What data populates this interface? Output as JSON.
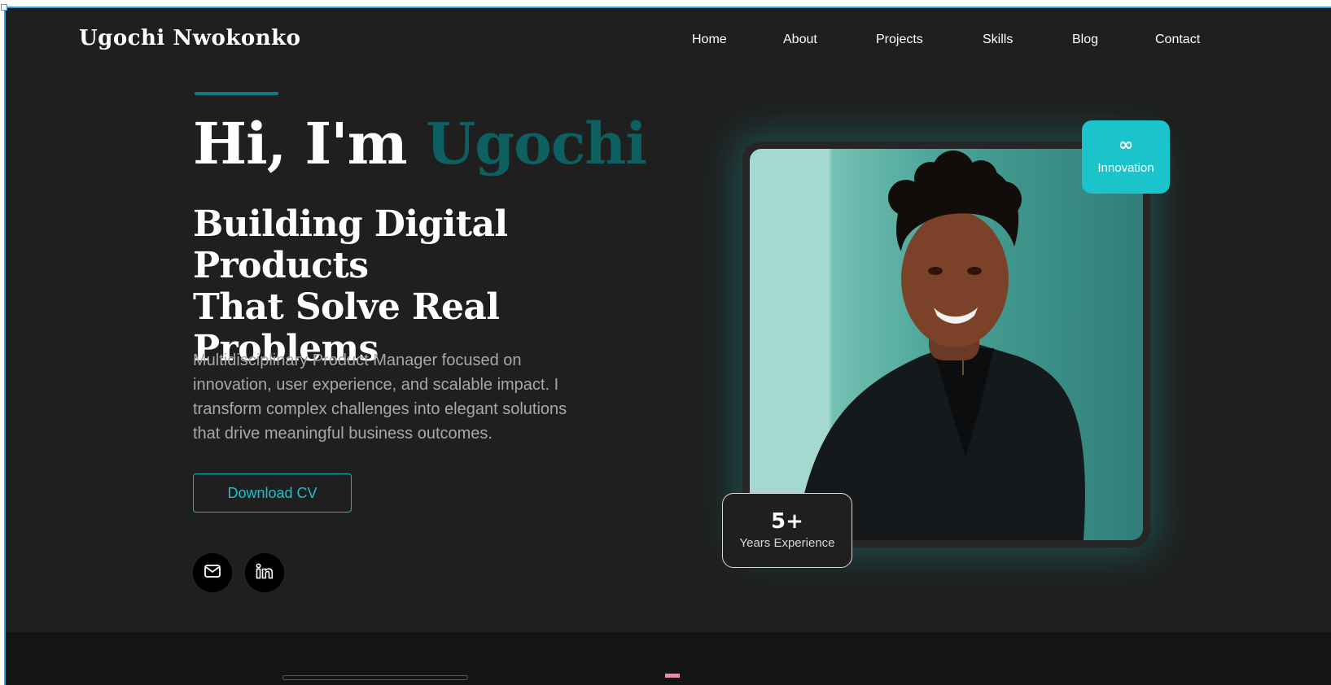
{
  "brand": {
    "name": "Ugochi Nwokonko"
  },
  "nav": {
    "items": [
      {
        "label": "Home"
      },
      {
        "label": "About"
      },
      {
        "label": "Projects"
      },
      {
        "label": "Skills"
      },
      {
        "label": "Blog"
      },
      {
        "label": "Contact"
      }
    ]
  },
  "hero": {
    "greeting": "Hi, I'm",
    "name": "Ugochi",
    "subtitle_lines": [
      "Building Digital Products",
      "That Solve Real",
      "Problems"
    ],
    "description_lines": [
      "Multidisciplinary Product Manager focused on",
      "innovation, user experience, and scalable impact. I",
      "transform complex challenges into elegant solutions",
      "that drive meaningful business outcomes."
    ],
    "cta_label": "Download CV",
    "social": [
      {
        "icon": "mail-icon"
      },
      {
        "icon": "linkedin-icon"
      }
    ]
  },
  "badges": {
    "innovation": {
      "symbol": "∞",
      "label": "Innovation"
    },
    "experience": {
      "value": "5+",
      "label": "Years Experience"
    }
  },
  "colors": {
    "background": "#1f1f1f",
    "accent_teal": "#16c3cf",
    "name_accent": "#0e5f5f",
    "section_dark": "#141414"
  }
}
